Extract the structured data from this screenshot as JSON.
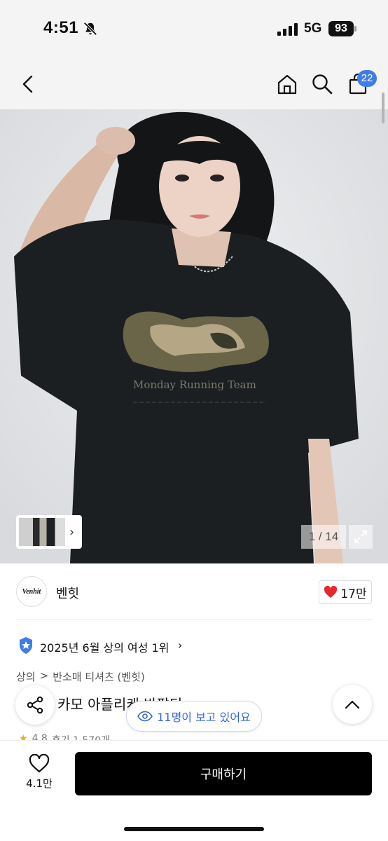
{
  "status_bar": {
    "time": "4:51",
    "network": "5G",
    "battery": "93"
  },
  "header": {
    "cart_count": "22"
  },
  "gallery": {
    "counter": "1 / 14"
  },
  "brand": {
    "logo_text": "Venhit",
    "name": "벤힛",
    "likes": "17만"
  },
  "ranking": {
    "text": "2025년 6월 상의 여성 1위"
  },
  "breadcrumb": {
    "level1": "상의",
    "separator": ">",
    "level2": "반소매 티셔츠 (벤힛)"
  },
  "product": {
    "title": "카모 아플리케 반팔티"
  },
  "viewers": {
    "text": "11명이 보고 있어요"
  },
  "rating": {
    "score": "4.8",
    "reviews": "후기 1,570개"
  },
  "bottom_bar": {
    "wish_count": "4.1만",
    "buy_label": "구매하기"
  },
  "shirt_print": {
    "script": "Monday Running Team"
  },
  "colors": {
    "accent": "#3f7de8",
    "heart": "#e8262d",
    "buy": "#000000"
  }
}
